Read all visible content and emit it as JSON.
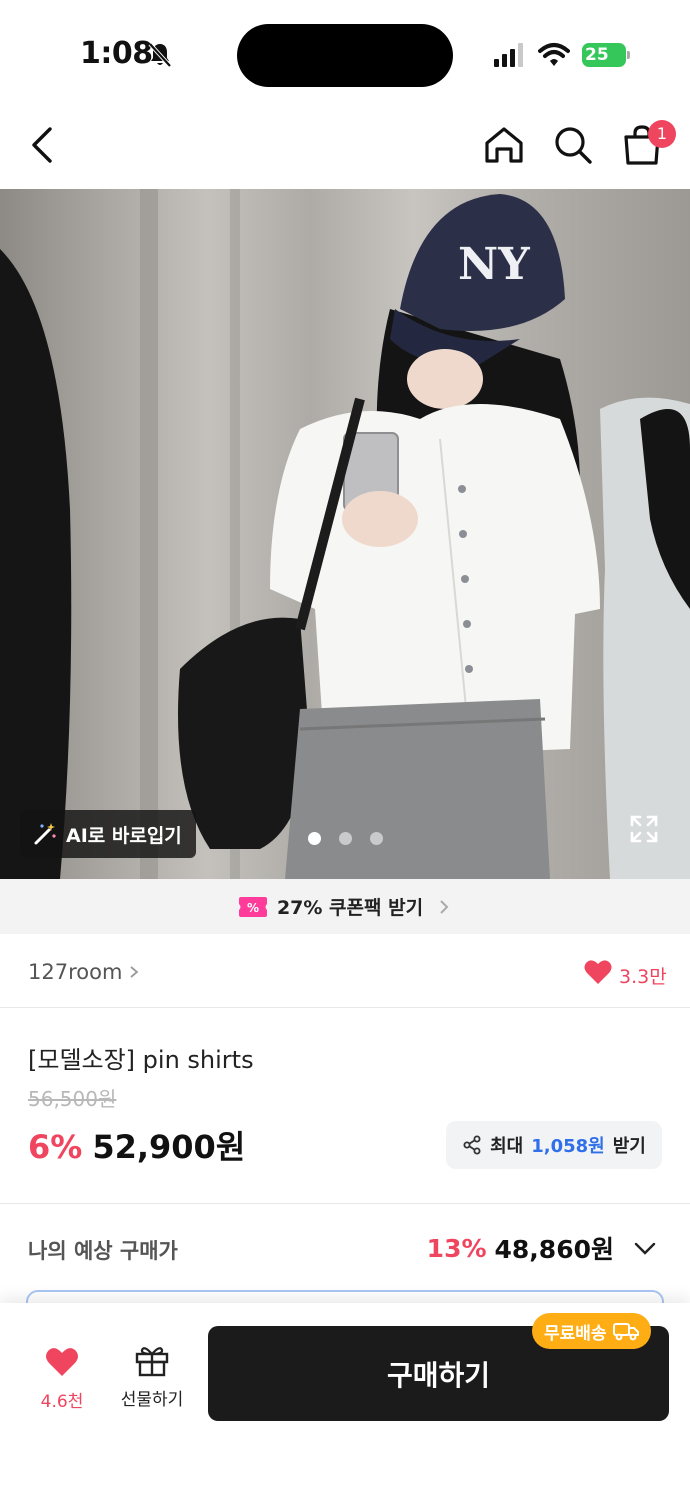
{
  "status": {
    "time": "1:08",
    "battery": "25"
  },
  "nav": {
    "cart_count": "1"
  },
  "photo": {
    "ai_label": "AI로 바로입기",
    "page_count": 3,
    "active_page": 1
  },
  "coupon": {
    "text": "27% 쿠폰팩 받기"
  },
  "shop": {
    "name": "127room",
    "likes": "3.3만"
  },
  "product": {
    "name": "[모델소장] pin shirts",
    "original_price": "56,500원",
    "discount": "6%",
    "price": "52,900원"
  },
  "share": {
    "prefix": "최대",
    "amount": "1,058원",
    "suffix": "받기"
  },
  "estimate": {
    "label": "나의 예상 구매가",
    "discount": "13%",
    "price": "48,860원"
  },
  "bottom": {
    "wish_count": "4.6천",
    "gift_label": "선물하기",
    "buy_label": "구매하기",
    "free_shipping": "무료배송"
  },
  "colors": {
    "accent": "#f0455e",
    "link": "#2f6fe8",
    "shipping": "#ffad14",
    "buy": "#1b1b1b"
  }
}
